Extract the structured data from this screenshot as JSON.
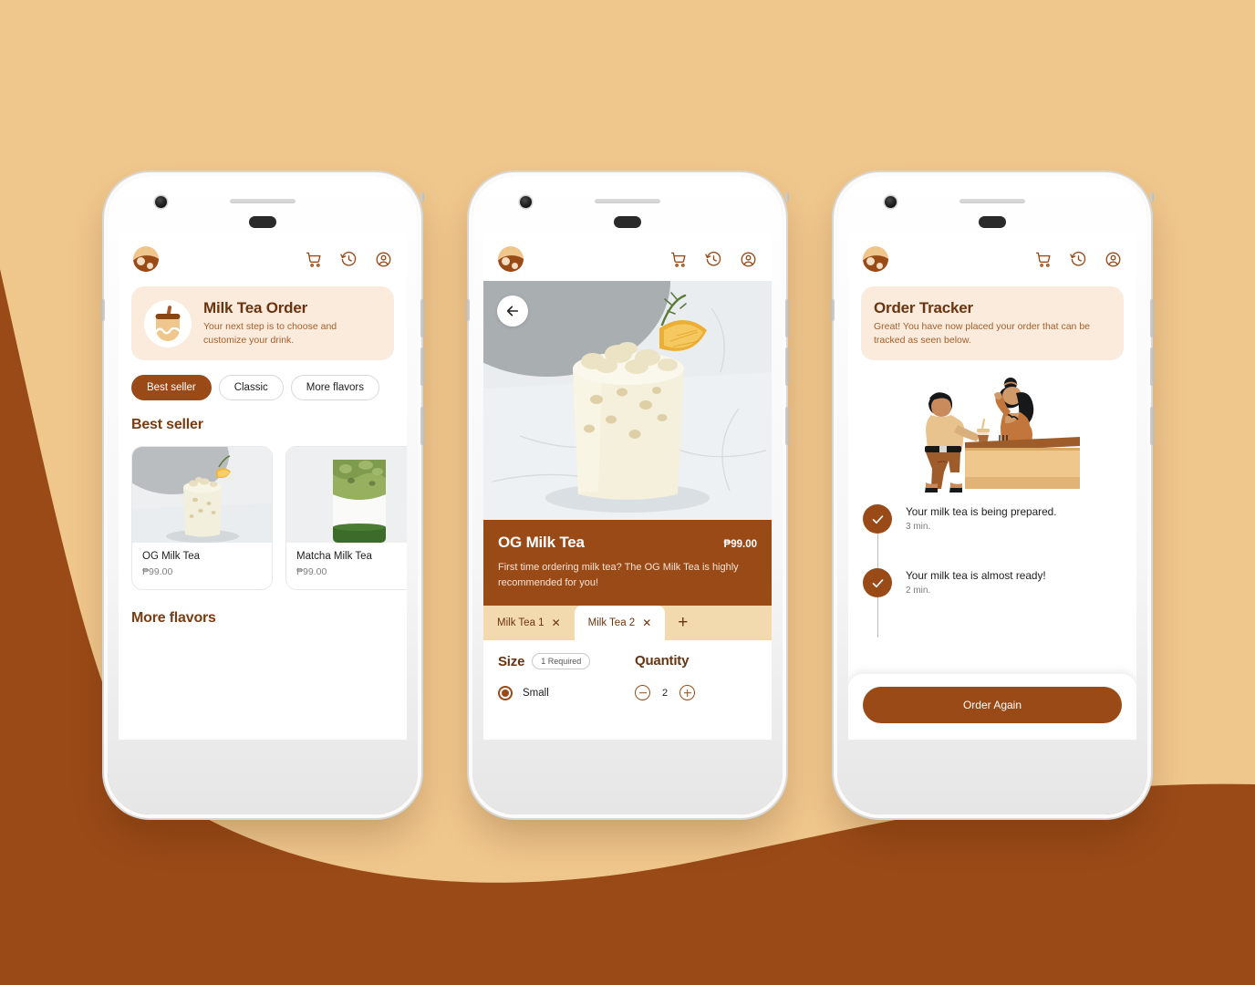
{
  "theme": {
    "bg_top": "#EFC68B",
    "bg_bottom": "#9A4A17",
    "primary": "#9A4A17",
    "banner_bg": "#FAEBDC",
    "tabbar_bg": "#F3D9AE",
    "heading": "#7A3C11"
  },
  "header": {
    "logo_name": "boba-logo",
    "icons": [
      {
        "name": "cart-icon",
        "label": "Cart"
      },
      {
        "name": "history-icon",
        "label": "Order history"
      },
      {
        "name": "account-icon",
        "label": "Account"
      }
    ]
  },
  "screen1": {
    "banner": {
      "title": "Milk Tea Order",
      "subtitle": "Your next step is to choose and customize your drink."
    },
    "chips": [
      {
        "label": "Best seller",
        "active": true
      },
      {
        "label": "Classic",
        "active": false
      },
      {
        "label": "More flavors",
        "active": false
      }
    ],
    "sections": [
      {
        "title": "Best seller",
        "products": [
          {
            "name": "OG Milk Tea",
            "price": "₱99.00",
            "image": "og-milk-tea-photo"
          },
          {
            "name": "Matcha Milk Tea",
            "price": "₱99.00",
            "image": "matcha-milk-tea-photo"
          }
        ]
      },
      {
        "title": "More flavors",
        "products": []
      }
    ]
  },
  "screen2": {
    "back_label": "Back",
    "hero_image": "og-milk-tea-hero-photo",
    "detail": {
      "name": "OG Milk Tea",
      "price": "₱99.00",
      "description": "First time ordering milk tea? The OG Milk Tea is highly recommended for you!"
    },
    "tabs": [
      {
        "label": "Milk Tea 1",
        "close": "✕",
        "active": false
      },
      {
        "label": "Milk Tea 2",
        "close": "✕",
        "active": true
      }
    ],
    "tab_add": "+",
    "options": {
      "size_title": "Size",
      "size_badge": "1 Required",
      "size_selected": "Small",
      "quantity_title": "Quantity",
      "quantity_value": "2",
      "minus": "−",
      "plus": "+"
    }
  },
  "screen3": {
    "banner": {
      "title": "Order Tracker",
      "subtitle": "Great! You have now placed your order that can be tracked as seen below."
    },
    "illustration": "barista-counter-illustration",
    "steps": [
      {
        "title": "Your milk tea is being prepared.",
        "time": "3 min.",
        "status": "done",
        "icon": "check-icon"
      },
      {
        "title": "Your milk tea is almost ready!",
        "time": "2 min.",
        "status": "done",
        "icon": "check-icon"
      }
    ],
    "order_again_label": "Order Again"
  }
}
